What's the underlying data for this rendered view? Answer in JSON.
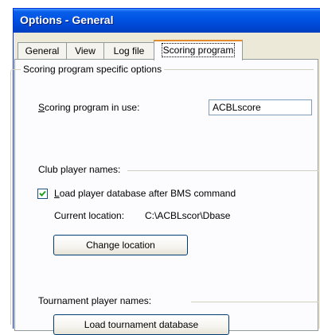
{
  "window": {
    "title": "Options - General"
  },
  "tabs": [
    {
      "label": "General",
      "active": false
    },
    {
      "label": "View",
      "active": false
    },
    {
      "label": "Log file",
      "active": false
    },
    {
      "label": "Scoring program",
      "active": true
    }
  ],
  "scoring_group": {
    "legend": "Scoring program specific options",
    "program_label_accel": "S",
    "program_label_rest": "coring program in use:",
    "program_value": "ACBLscore"
  },
  "club": {
    "heading": "Club player names:",
    "load_checkbox_accel": "L",
    "load_checkbox_rest": "oad player database after BMS command",
    "load_checked": true,
    "current_location_label": "Current location:",
    "current_location_value": "C:\\ACBLscor\\Dbase",
    "change_location_button": "Change location"
  },
  "tournament": {
    "heading": "Tournament player names:",
    "load_button": "Load tournament database"
  }
}
